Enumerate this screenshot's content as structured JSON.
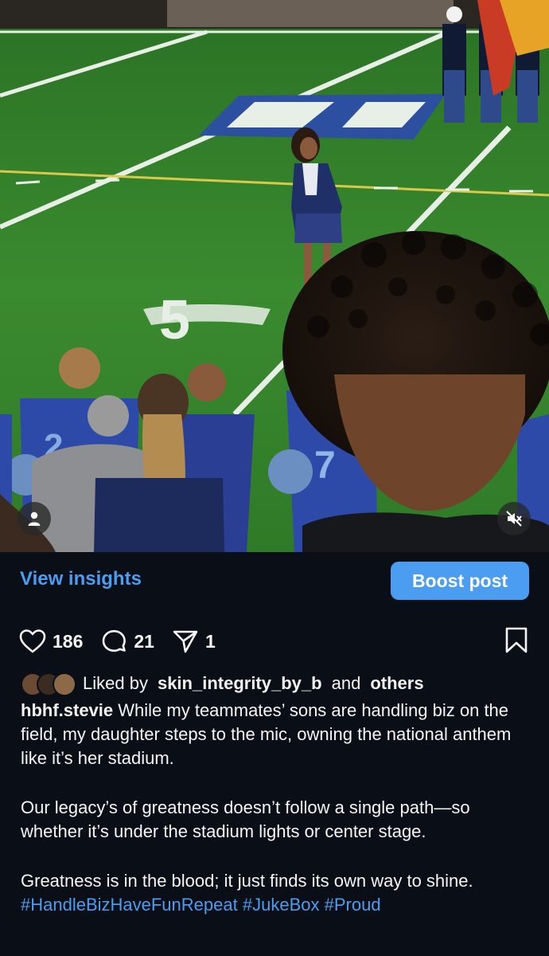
{
  "media": {
    "field_number": "5",
    "icons": {
      "profile": "person-icon",
      "mute": "speaker-muted-icon"
    }
  },
  "insights_bar": {
    "view_insights_label": "View insights",
    "boost_label": "Boost post"
  },
  "actions": {
    "likes": "186",
    "comments": "21",
    "shares": "1",
    "icons": {
      "like": "heart-icon",
      "comment": "comment-bubble-icon",
      "share": "paper-plane-icon",
      "save": "bookmark-icon"
    }
  },
  "liked_by": {
    "prefix": "Liked by",
    "user": "skin_integrity_by_b",
    "connector": "and",
    "others": "others"
  },
  "caption": {
    "username": "hbhf.stevie",
    "paragraph1": "While my teammates’ sons are handling biz on the field, my daughter steps to the mic, owning the national anthem like it’s her stadium.",
    "paragraph2": "Our legacy’s of greatness doesn’t follow a single path—so whether it’s under the stadium lights or center stage.",
    "paragraph3": "Greatness is in the blood; it just finds its own way to shine.",
    "hashtags": [
      "#HandleBizHaveFunRepeat",
      "#JukeBox",
      "#Proud"
    ]
  },
  "colors": {
    "accent": "#4a9df0",
    "background": "#0a0e17",
    "text": "#f5f5f5"
  }
}
